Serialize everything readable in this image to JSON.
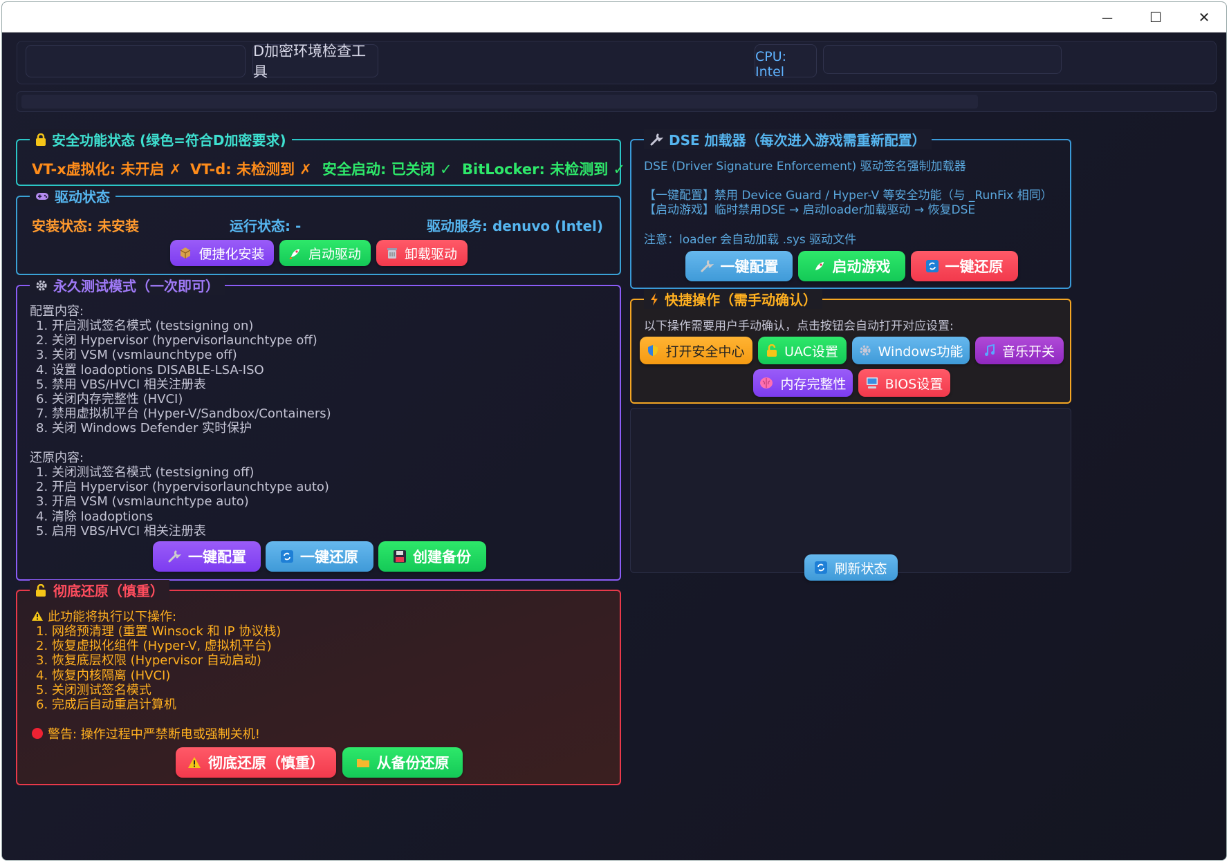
{
  "titlebar": {
    "minimize": "—",
    "maximize": "☐",
    "close": "✕"
  },
  "header": {
    "title": "D加密环境检查工具",
    "cpu": "CPU: Intel"
  },
  "security": {
    "title": "安全功能状态 (绿色=符合D加密要求)",
    "vtx": "VT-x虚拟化: 未开启 ✗",
    "vtd": "VT-d: 未检测到 ✗",
    "secureboot": "安全启动: 已关闭 ✓",
    "bitlocker": "BitLocker: 未检测到 ✓"
  },
  "driver": {
    "title": "驱动状态",
    "install": "安装状态: 未安装",
    "run": "运行状态: -",
    "service": "驱动服务: denuvo (Intel)",
    "btn_install": "便捷化安装",
    "btn_start": "启动驱动",
    "btn_uninstall": "卸载驱动"
  },
  "testmode": {
    "title": "永久测试模式（一次即可）",
    "config_header": "配置内容:",
    "config_items": [
      "1. 开启测试签名模式 (testsigning on)",
      "2. 关闭 Hypervisor (hypervisorlaunchtype off)",
      "3. 关闭 VSM (vsmlaunchtype off)",
      "4. 设置 loadoptions DISABLE-LSA-ISO",
      "5. 禁用 VBS/HVCI 相关注册表",
      "6. 关闭内存完整性 (HVCI)",
      "7. 禁用虚拟机平台 (Hyper-V/Sandbox/Containers)",
      "8. 关闭 Windows Defender 实时保护"
    ],
    "restore_header": "还原内容:",
    "restore_items": [
      "1. 关闭测试签名模式 (testsigning off)",
      "2. 开启 Hypervisor (hypervisorlaunchtype auto)",
      "3. 开启 VSM (vsmlaunchtype auto)",
      "4. 清除 loadoptions",
      "5. 启用 VBS/HVCI 相关注册表"
    ],
    "btn_config": "一键配置",
    "btn_restore": "一键还原",
    "btn_backup": "创建备份"
  },
  "fullrestore": {
    "title": "彻底还原（慎重）",
    "header": "此功能将执行以下操作:",
    "items": [
      "1. 网络预清理 (重置 Winsock 和 IP 协议栈)",
      "2. 恢复虚拟化组件 (Hyper-V, 虚拟机平台)",
      "3. 恢复底层权限 (Hypervisor 自动启动)",
      "4. 恢复内核隔离 (HVCI)",
      "5. 关闭测试签名模式",
      "6. 完成后自动重启计算机"
    ],
    "warning": "警告: 操作过程中严禁断电或强制关机!",
    "btn_full": "彻底还原（慎重）",
    "btn_backup_restore": "从备份还原"
  },
  "dse": {
    "title": "DSE 加载器（每次进入游戏需重新配置）",
    "desc": "DSE (Driver Signature Enforcement) 驱动签名强制加载器",
    "line1": "【一键配置】禁用 Device Guard / Hyper-V 等安全功能（与 _RunFix 相同）",
    "line2": "【启动游戏】临时禁用DSE → 启动loader加载驱动 → 恢复DSE",
    "note": "注意：loader 会自动加载 .sys 驱动文件",
    "btn_config": "一键配置",
    "btn_launch": "启动游戏",
    "btn_restore": "一键还原"
  },
  "quick": {
    "title": "快捷操作（需手动确认）",
    "desc": "以下操作需要用户手动确认，点击按钮会自动打开对应设置:",
    "btn_security": "打开安全中心",
    "btn_uac": "UAC设置",
    "btn_windows": "Windows功能",
    "btn_music": "音乐开关",
    "btn_memory": "内存完整性",
    "btn_bios": "BIOS设置"
  },
  "refresh": "刷新状态",
  "colors": {
    "green": "#2ee86a",
    "orange": "#ffb020",
    "red": "#ff4d5e",
    "blue": "#56aee8",
    "purple": "#8b5cf6"
  }
}
